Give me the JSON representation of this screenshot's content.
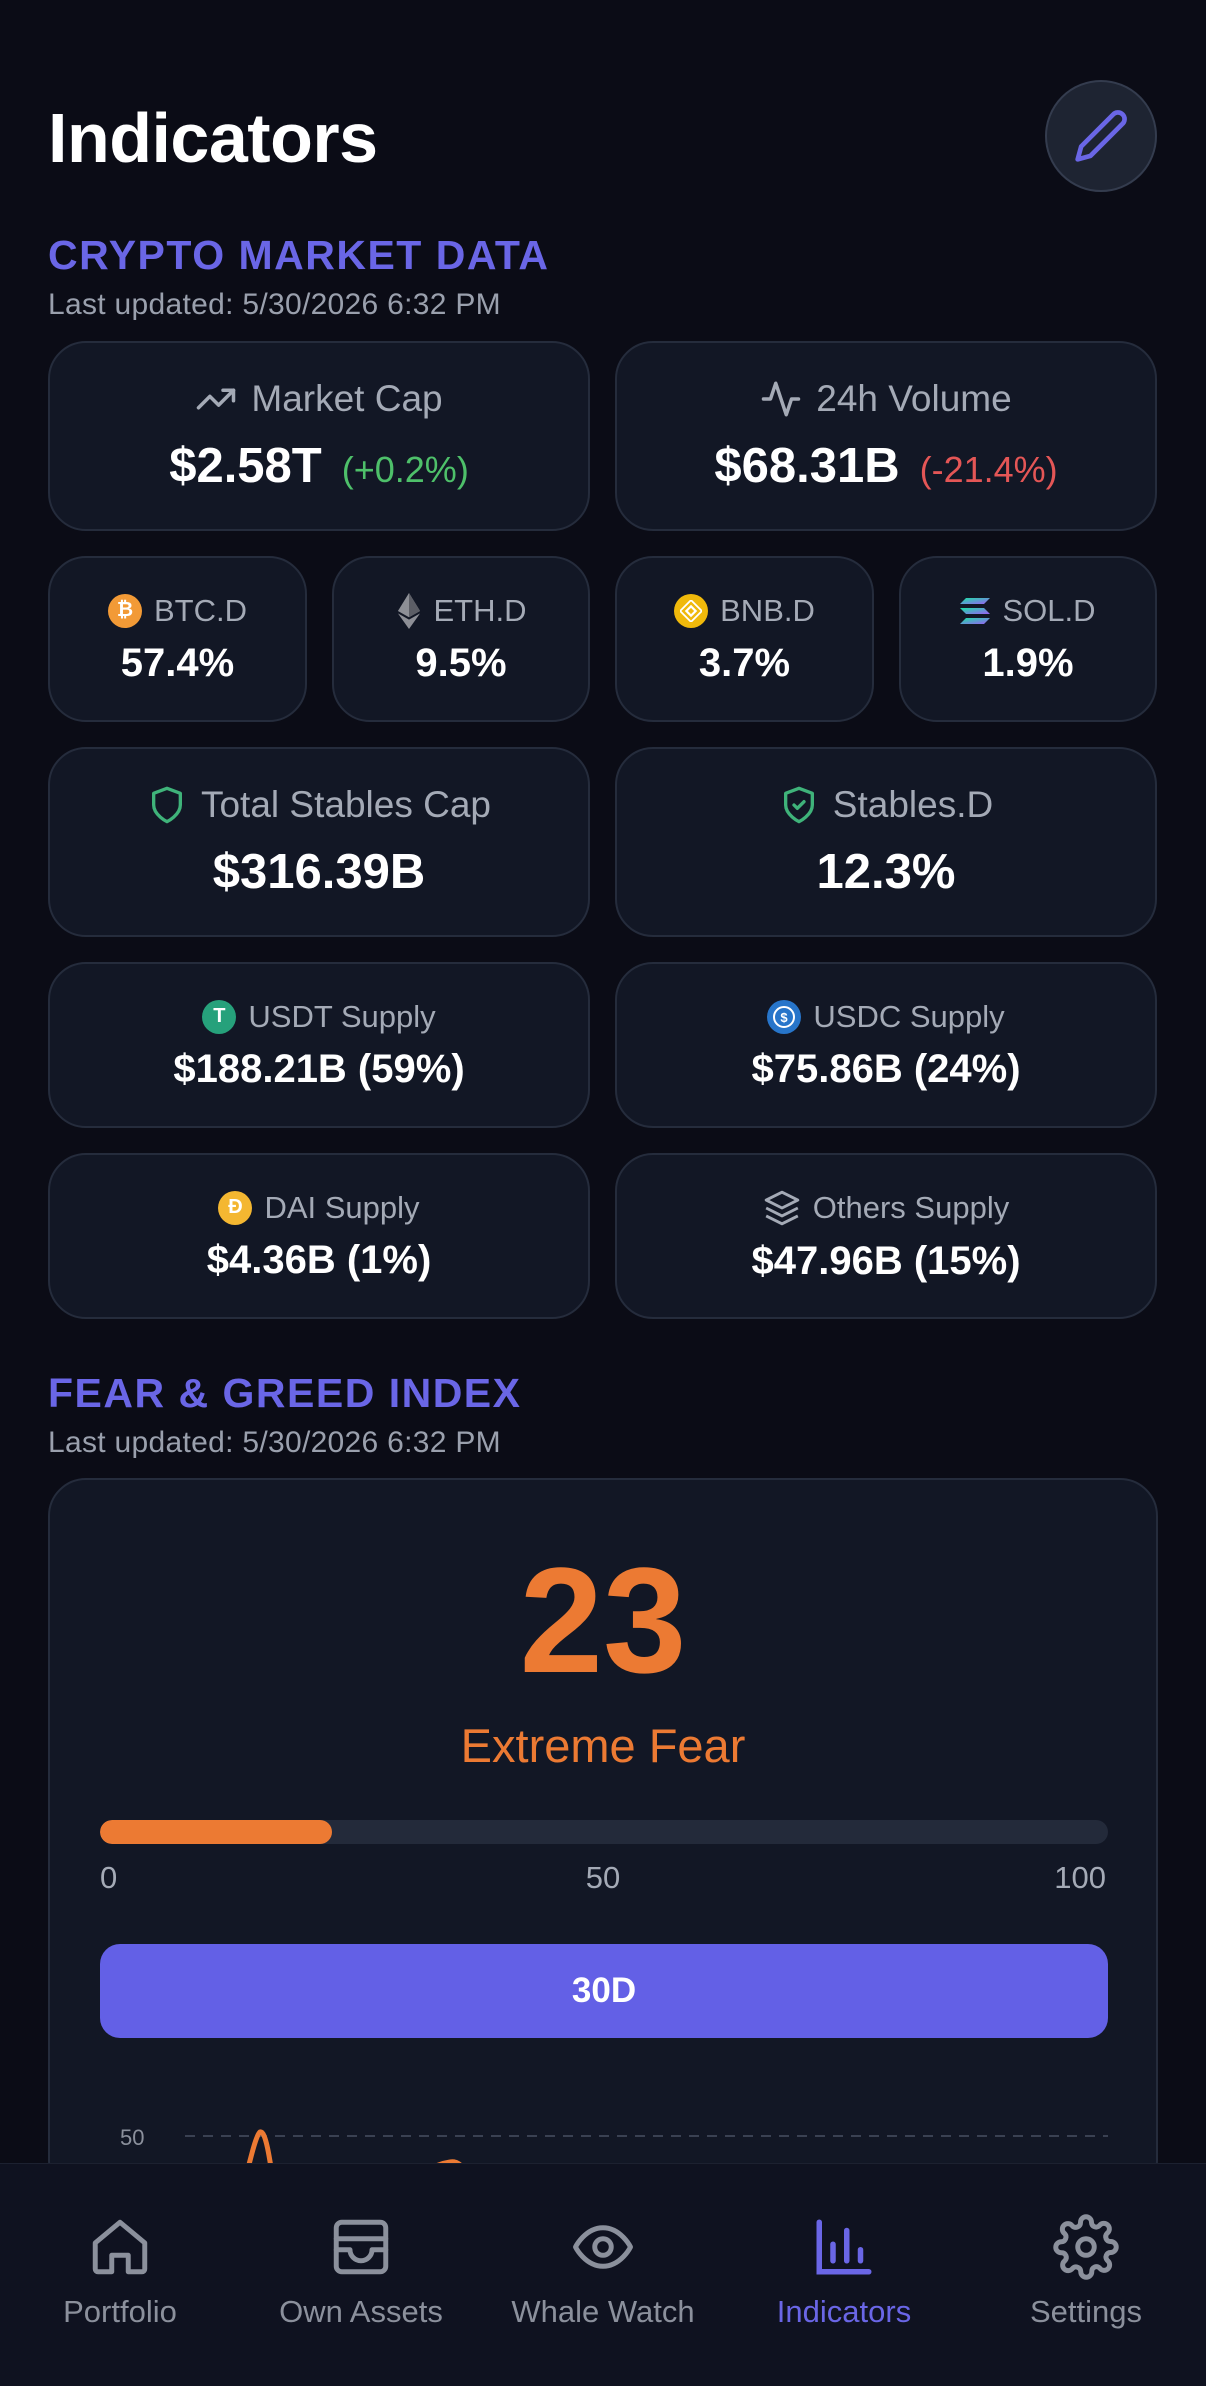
{
  "header": {
    "title": "Indicators",
    "edit_icon": "pencil-icon"
  },
  "market": {
    "section_title": "CRYPTO MARKET DATA",
    "updated": "Last updated: 5/30/2026 6:32 PM",
    "market_cap": {
      "label": "Market Cap",
      "value": "$2.58T",
      "change": "(+0.2%)",
      "icon": "trending-up-icon"
    },
    "volume": {
      "label": "24h Volume",
      "value": "$68.31B",
      "change": "(-21.4%)",
      "icon": "activity-icon"
    },
    "dominance": [
      {
        "label": "BTC.D",
        "value": "57.4%",
        "icon": "bitcoin-icon",
        "color": "#f29a36"
      },
      {
        "label": "ETH.D",
        "value": "9.5%",
        "icon": "ethereum-icon",
        "color": "#8d8f96"
      },
      {
        "label": "BNB.D",
        "value": "3.7%",
        "icon": "bnb-icon",
        "color": "#f0b90b"
      },
      {
        "label": "SOL.D",
        "value": "1.9%",
        "icon": "solana-icon",
        "color": "#9b5cf6"
      }
    ],
    "stables_cap": {
      "label": "Total Stables Cap",
      "value": "$316.39B",
      "icon": "shield-icon"
    },
    "stables_d": {
      "label": "Stables.D",
      "value": "12.3%",
      "icon": "shield-check-icon"
    },
    "supplies": [
      {
        "label": "USDT Supply",
        "value": "$188.21B (59%)",
        "icon": "tether-icon",
        "color": "#26a17b"
      },
      {
        "label": "USDC Supply",
        "value": "$75.86B (24%)",
        "icon": "usdc-icon",
        "color": "#2775ca"
      },
      {
        "label": "DAI Supply",
        "value": "$4.36B (1%)",
        "icon": "dai-icon",
        "color": "#f4b731"
      },
      {
        "label": "Others Supply",
        "value": "$47.96B (15%)",
        "icon": "layers-icon",
        "color": "#a4aab6"
      }
    ],
    "colors": {
      "up": "#4ec06a",
      "down": "#e45656",
      "shield": "#3fb37a"
    }
  },
  "fear_greed": {
    "section_title": "FEAR & GREED INDEX",
    "updated": "Last updated: 5/30/2026 6:32 PM",
    "value": "23",
    "level": 23,
    "classification": "Extreme Fear",
    "scale_min": "0",
    "scale_mid": "50",
    "scale_max": "100",
    "range_button": "30D",
    "chart_axis_label": "50",
    "color": "#ec7a33"
  },
  "tabs": [
    {
      "label": "Portfolio",
      "icon": "home-icon",
      "active": false
    },
    {
      "label": "Own Assets",
      "icon": "wallet-icon",
      "active": false
    },
    {
      "label": "Whale Watch",
      "icon": "eye-icon",
      "active": false
    },
    {
      "label": "Indicators",
      "icon": "bar-chart-icon",
      "active": true
    },
    {
      "label": "Settings",
      "icon": "gear-icon",
      "active": false
    }
  ]
}
